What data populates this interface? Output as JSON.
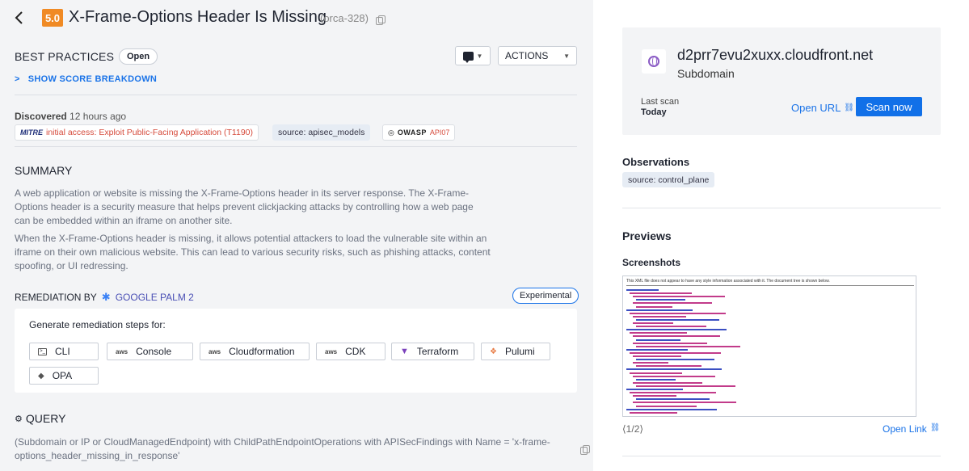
{
  "header": {
    "score": "5.0",
    "title": "X-Frame-Options Header Is Missing",
    "alert_id": "(orca-328)"
  },
  "meta": {
    "category": "BEST PRACTICES",
    "status": "Open",
    "actions_label": "ACTIONS",
    "score_breakdown_label": "SHOW SCORE BREAKDOWN"
  },
  "discovered": {
    "label": "Discovered",
    "value": "12 hours ago"
  },
  "tags": {
    "mitre_logo": "MITRE",
    "mitre_text": "initial access: Exploit Public-Facing Application (T1190)",
    "source": "source: apisec_models",
    "owasp_logo": "OWASP",
    "owasp_id": "API07"
  },
  "summary": {
    "title": "SUMMARY",
    "para1": "A web application or website is missing the X-Frame-Options header in its server response. The X-Frame-Options header is a security measure that helps prevent clickjacking attacks by controlling how a web page can be embedded within an iframe on another site.",
    "para2": "When the X-Frame-Options header is missing, it allows potential attackers to load the vulnerable site within an iframe on their own malicious website. This can lead to various security risks, such as phishing attacks, content spoofing, or UI redressing."
  },
  "remediation": {
    "title": "REMEDIATION BY",
    "provider": "GOOGLE PALM 2",
    "badge": "Experimental",
    "prompt": "Generate remediation steps for:",
    "tools": [
      {
        "label": "CLI",
        "icon": "terminal-icon"
      },
      {
        "label": "Console",
        "icon": "aws-icon"
      },
      {
        "label": "Cloudformation",
        "icon": "aws-icon"
      },
      {
        "label": "CDK",
        "icon": "aws-icon"
      },
      {
        "label": "Terraform",
        "icon": "terraform-icon"
      },
      {
        "label": "Pulumi",
        "icon": "pulumi-icon"
      },
      {
        "label": "OPA",
        "icon": "opa-icon"
      }
    ],
    "aws_glyph": "aws"
  },
  "query": {
    "title": "QUERY",
    "text": "(Subdomain or IP or CloudManagedEndpoint) with ChildPathEndpointOperations with APISecFindings with Name = 'x-frame-options_header_missing_in_response'"
  },
  "asset": {
    "name": "d2prr7evu2xuxx.cloudfront.net",
    "type": "Subdomain",
    "last_scan_label": "Last scan",
    "last_scan_value": "Today",
    "open_url": "Open URL",
    "scan_now": "Scan now"
  },
  "observations": {
    "title": "Observations",
    "tag": "source: control_plane"
  },
  "previews": {
    "title": "Previews",
    "screenshots_title": "Screenshots",
    "screenshot_header": "This XML file does not appear to have any style information associated with it. The document tree is shown below.",
    "pager": "⟨1/2⟩",
    "open_link": "Open Link"
  }
}
